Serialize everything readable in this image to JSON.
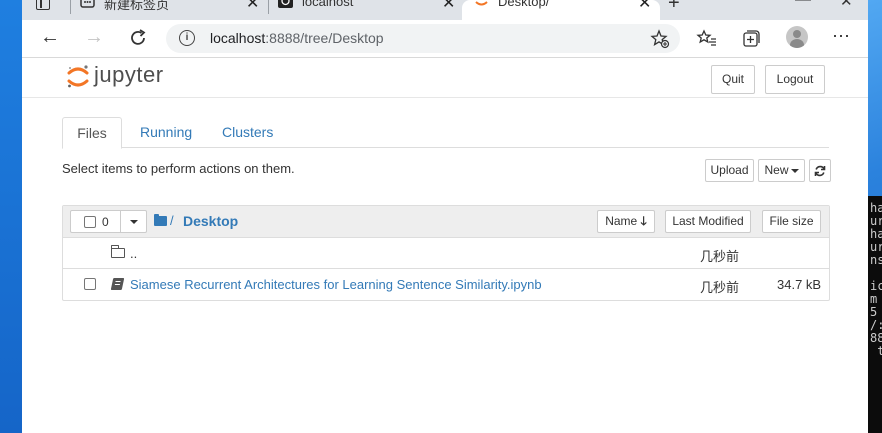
{
  "browser": {
    "tabs": [
      {
        "title": "新建标签页",
        "active": false
      },
      {
        "title": "localhost",
        "active": false
      },
      {
        "title": "Desktop/",
        "active": true
      }
    ],
    "url": {
      "host": "localhost",
      "path": ":8888/tree/Desktop"
    }
  },
  "header": {
    "logo_text": "jupyter",
    "quit_label": "Quit",
    "logout_label": "Logout"
  },
  "nav_tabs": [
    {
      "label": "Files",
      "active": true
    },
    {
      "label": "Running",
      "active": false
    },
    {
      "label": "Clusters",
      "active": false
    }
  ],
  "toolbar": {
    "hint": "Select items to perform actions on them.",
    "upload_label": "Upload",
    "new_label": "New",
    "refresh_icon": "refresh-icon"
  },
  "listing": {
    "selected_count": "0",
    "breadcrumb_sep": "/",
    "breadcrumb": "Desktop",
    "columns": {
      "name": "Name",
      "last_modified": "Last Modified",
      "file_size": "File size"
    },
    "rows": [
      {
        "name": "..",
        "type": "folder",
        "modified": "几秒前",
        "size": ""
      },
      {
        "name": "Siamese Recurrent Architectures for Learning Sentence Similarity.ipynb",
        "type": "notebook",
        "modified": "几秒前",
        "size": "34.7 kB"
      }
    ]
  },
  "terminal": {
    "lines": [
      "ha",
      "ur",
      "ha",
      "ur",
      "ns",
      "",
      "ic",
      "m",
      "5",
      "/:",
      "88",
      " t"
    ]
  },
  "colors": {
    "link": "#337ab7",
    "desktop": "#1d6fd0",
    "tabbar": "#dfe3e8"
  }
}
